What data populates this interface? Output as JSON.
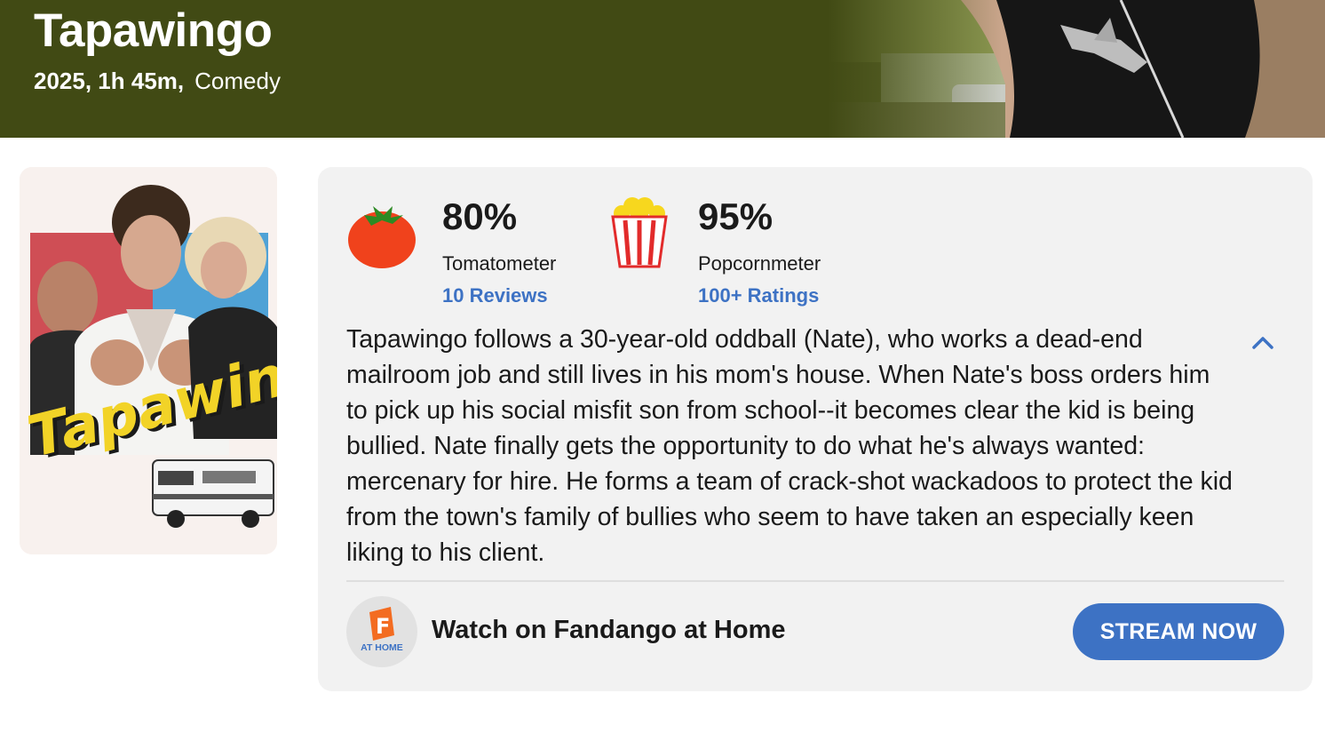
{
  "hero": {
    "title": "Tapawingo",
    "meta_year_runtime": "2025, 1h 45m,",
    "meta_genre": "Comedy",
    "background_color": "#414a14"
  },
  "poster": {
    "title_art": "Tapawingo"
  },
  "scores": {
    "tomatometer": {
      "icon": "tomato-icon",
      "value": "80%",
      "label": "Tomatometer",
      "link": "10 Reviews"
    },
    "popcornmeter": {
      "icon": "popcorn-icon",
      "value": "95%",
      "label": "Popcornmeter",
      "link": "100+ Ratings"
    }
  },
  "synopsis": {
    "text": "Tapawingo follows a 30-year-old oddball (Nate), who works a dead-end mailroom job and still lives in his mom's house. When Nate's boss orders him to pick up his social misfit son from school--it becomes clear the kid is being bullied. Nate finally gets the opportunity to do what he's always wanted: mercenary for hire. He forms a team of crack-shot wackadoos to protect the kid from the town's family of bullies who seem to have taken an especially keen liking to his client.",
    "toggle_icon": "chevron-up-icon"
  },
  "streaming": {
    "logo_icon": "fandango-at-home-icon",
    "logo_letter": "F",
    "logo_subtext": "AT HOME",
    "label": "Watch on Fandango at Home",
    "button": "STREAM NOW"
  },
  "colors": {
    "accent": "#3d72c4",
    "panel": "#f2f2f2",
    "tomato": "#f0421c",
    "fandango": "#f36c21"
  }
}
